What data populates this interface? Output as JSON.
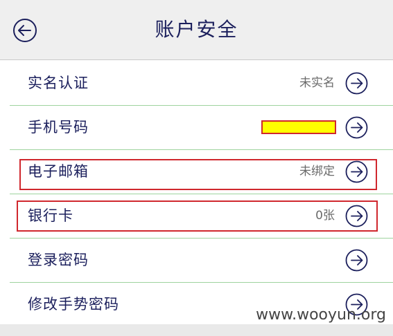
{
  "header": {
    "title": "账户安全",
    "back_icon": "back-arrow-circle-icon"
  },
  "rows": [
    {
      "label": "实名认证",
      "value": "未实名"
    },
    {
      "label": "手机号码",
      "value": ""
    },
    {
      "label": "电子邮箱",
      "value": "未绑定"
    },
    {
      "label": "银行卡",
      "value": "0张"
    },
    {
      "label": "登录密码",
      "value": ""
    },
    {
      "label": "修改手势密码",
      "value": ""
    }
  ],
  "row_arrow_icon": "chevron-right-circle-icon",
  "colors": {
    "text": "#1b1f5c",
    "divider": "#9ed39e",
    "highlight": "#d0272d",
    "redaction": "#ffff00"
  },
  "watermark": "www.wooyun.org"
}
